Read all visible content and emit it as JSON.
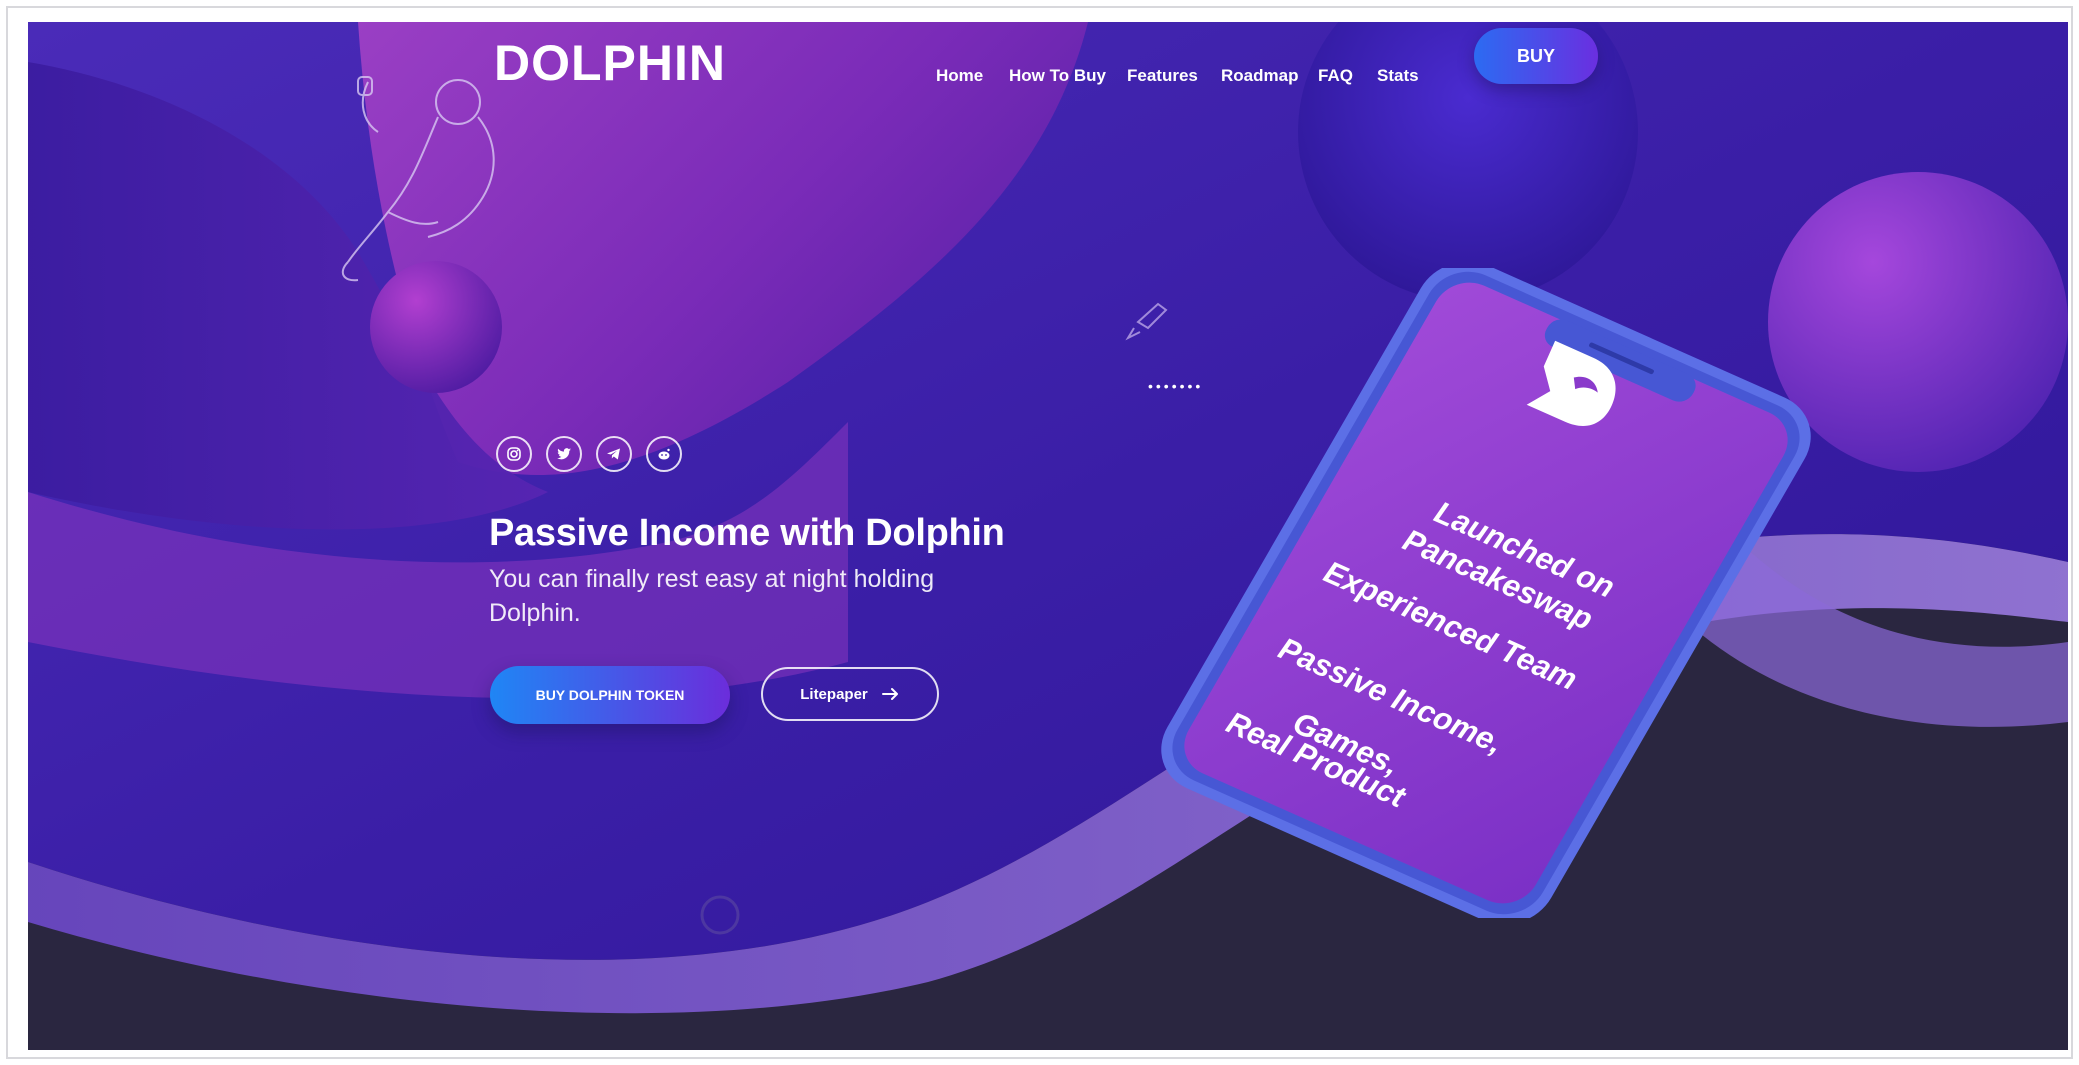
{
  "brand": {
    "name": "DOLPHIN"
  },
  "nav": {
    "links": [
      "Home",
      "How To Buy",
      "Features",
      "Roadmap",
      "FAQ",
      "Stats"
    ],
    "buy_label": "BUY"
  },
  "social": [
    "instagram-icon",
    "twitter-icon",
    "telegram-icon",
    "reddit-icon"
  ],
  "hero": {
    "title": "Passive Income with Dolphin",
    "subtitle": "You can finally rest easy at night holding Dolphin.",
    "primary_button": "BUY DOLPHIN TOKEN",
    "secondary_button": "Litepaper"
  },
  "carousel_dots": "•••••••",
  "phone": {
    "lines": [
      "Launched on",
      "Pancakeswap",
      "Experienced Team",
      "Passive Income,",
      "Games,",
      "Real Product"
    ]
  },
  "colors": {
    "background_purple": "#3a1fa8",
    "dark_floor": "#2a2640",
    "accent_blue": "#2c6bf2",
    "accent_violet": "#6a2fe0"
  }
}
